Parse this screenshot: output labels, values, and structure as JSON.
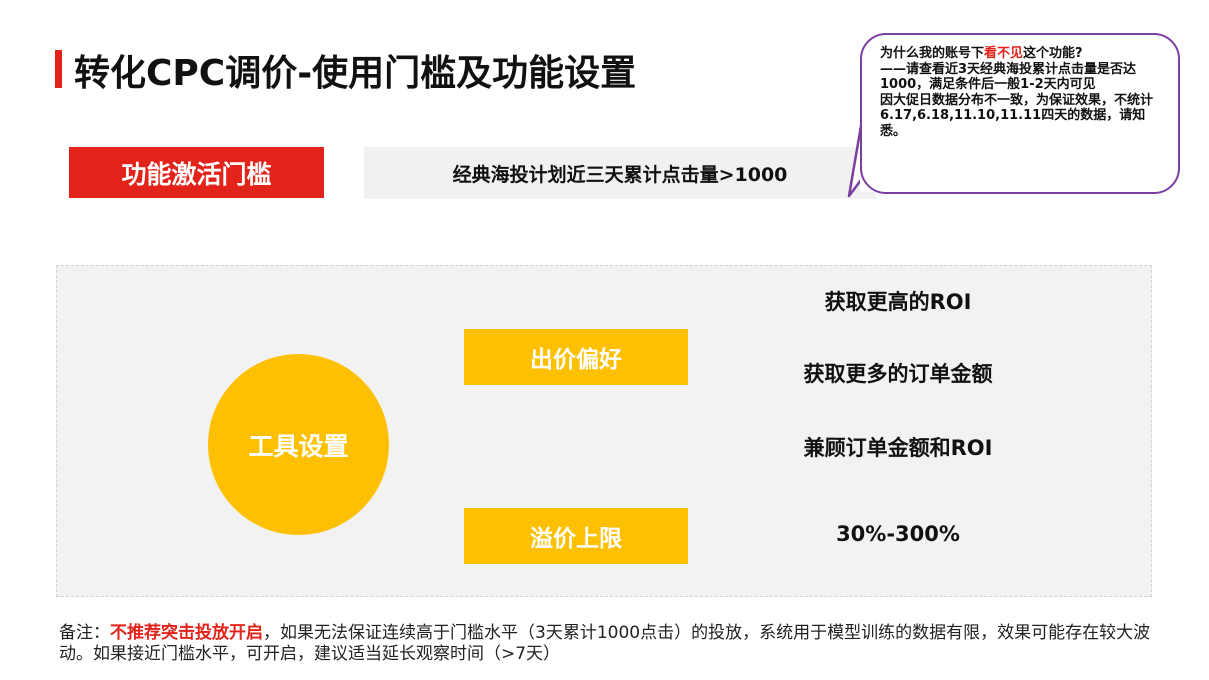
{
  "title": "转化CPC调价-使用门槛及功能设置",
  "threshold": {
    "label": "功能激活门槛",
    "value": "经典海投计划近三天累计点击量>1000"
  },
  "callout": {
    "question_prefix": "为什么我的账号下",
    "question_highlight": "看不见",
    "question_suffix": "这个功能?",
    "line2": "——请查看近3天经典海投累计点击量是否达1000，满足条件后一般1-2天内可见",
    "line3": "因大促日数据分布不一致，为保证效果，不统计6.17,6.18,11.10,11.11四天的数据，请知悉。"
  },
  "settings": {
    "tool_label": "工具设置",
    "bid_pref_label": "出价偏好",
    "bid_options": [
      "获取更高的ROI",
      "获取更多的订单金额",
      "兼顾订单金额和ROI"
    ],
    "cap_label": "溢价上限",
    "cap_value": "30%-300%"
  },
  "note": {
    "prefix": "备注：",
    "highlight": "不推荐突击投放开启",
    "text": "，如果无法保证连续高于门槛水平（3天累计1000点击）的投放，系统用于模型训练的数据有限，效果可能存在较大波动。如果接近门槛水平，可开启，建议适当延长观察时间（>7天）"
  },
  "colors": {
    "accent_red": "#e2231a",
    "accent_yellow": "#fec000",
    "callout_border": "#7b3fa0",
    "panel_bg": "#f2f2f2"
  }
}
